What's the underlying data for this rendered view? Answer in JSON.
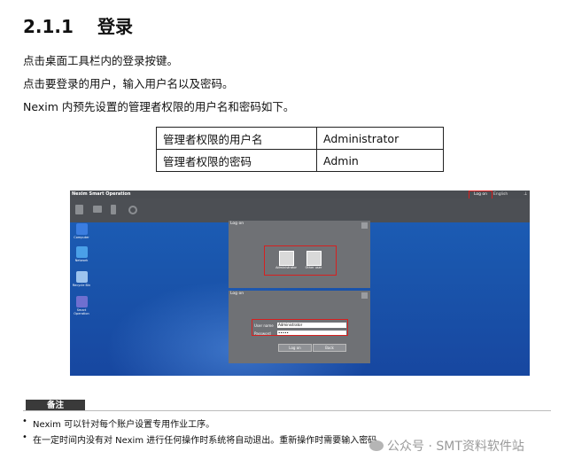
{
  "section": {
    "number": "2.1.1",
    "title": "登录"
  },
  "paragraphs": [
    "点击桌面工具栏内的登录按键。",
    "点击要登录的用户，输入用户名以及密码。",
    "Nexim 内预先设置的管理者权限的用户名和密码如下。"
  ],
  "credentials_table": [
    [
      "管理者权限的用户名",
      "Administrator"
    ],
    [
      "管理者权限的密码",
      "Admin"
    ]
  ],
  "screenshot": {
    "app_title": "Nexim Smart Operation",
    "logon_button": "Log on",
    "language": "English",
    "desktop_icons": [
      "Computer",
      "Network",
      "Recycle Bin",
      "Smart Operation"
    ],
    "panel1_title": "Log on",
    "users": [
      "Administrator",
      "Other user"
    ],
    "panel2_title": "Log on",
    "user_name_label": "User name",
    "user_name_value": "Administrator",
    "password_label": "Password",
    "password_value": "•••••",
    "logon_action": "Log on",
    "back_action": "Back"
  },
  "note": {
    "label": "备注",
    "items": [
      "Nexim 可以针对每个账户设置专用作业工序。",
      "在一定时间内没有对 Nexim 进行任何操作时系统将自动退出。重新操作时需要输入密码。"
    ]
  },
  "watermark": "公众号 · SMT资料软件站",
  "colors": {
    "desktop_blue": "#1a56ad",
    "toolbar_gray": "#4c4f54",
    "highlight_red": "#d62020"
  }
}
